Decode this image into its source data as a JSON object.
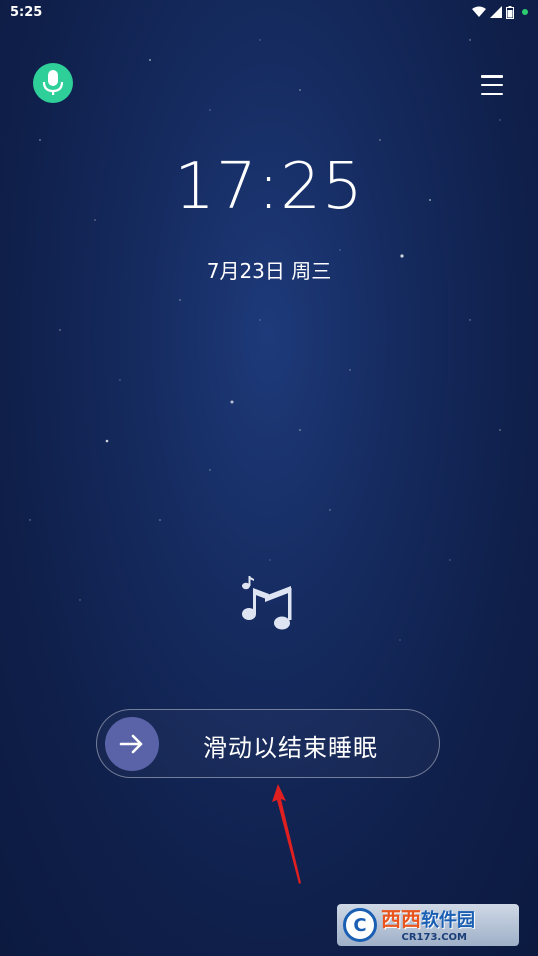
{
  "status_bar": {
    "time": "5:25",
    "icons": [
      "wifi-icon",
      "signal-icon",
      "battery-icon"
    ],
    "dot_color": "#2ecc71"
  },
  "top_bar": {
    "mic_icon": "microphone-icon",
    "mic_color": "#2ecf98",
    "menu_icon": "hamburger-menu-icon"
  },
  "clock": {
    "time": "17:25",
    "date": "7月23日 周三"
  },
  "music": {
    "icon": "music-note-icon"
  },
  "slider": {
    "label": "滑动以结束睡眠",
    "knob_icon": "arrow-right-icon",
    "knob_color": "#5a63a8"
  },
  "watermark": {
    "logo_letter": "C",
    "text_main": "西西",
    "text_suffix": "软件园",
    "domain": "CR173.COM"
  }
}
